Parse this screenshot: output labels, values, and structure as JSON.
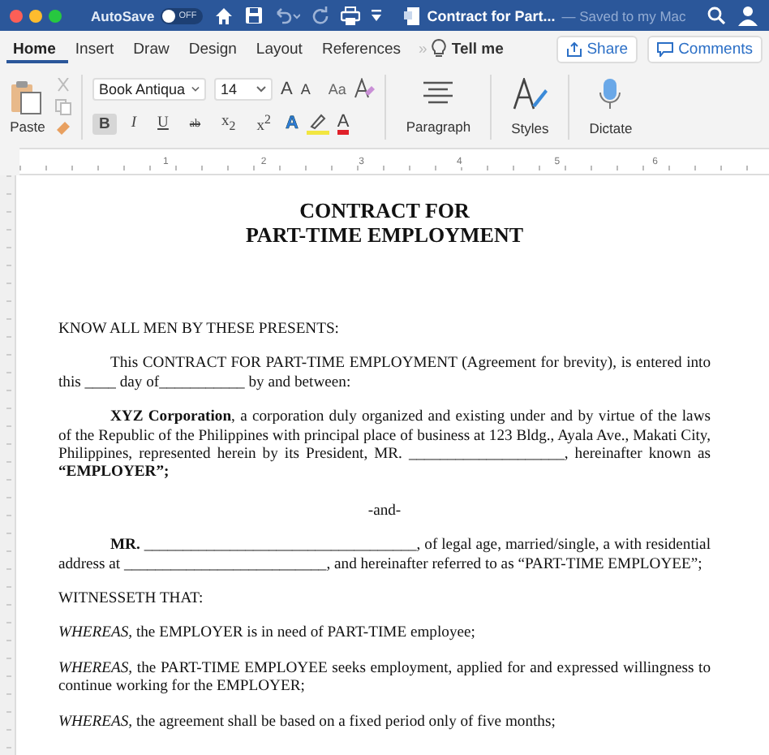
{
  "titlebar": {
    "autosave": {
      "label": "AutoSave",
      "on": false,
      "state_text": "OFF"
    },
    "document_title": "Contract for Part...",
    "saved_status": "— Saved to my Mac"
  },
  "tabs": [
    {
      "label": "Home",
      "selected": true
    },
    {
      "label": "Insert",
      "selected": false
    },
    {
      "label": "Draw",
      "selected": false
    },
    {
      "label": "Design",
      "selected": false
    },
    {
      "label": "Layout",
      "selected": false
    },
    {
      "label": "References",
      "selected": false
    }
  ],
  "overflow": "»",
  "tell_me": "Tell me",
  "share": "Share",
  "comments": "Comments",
  "ribbon": {
    "paste": "Paste",
    "font": {
      "name": "Book Antiqua",
      "size": "14"
    },
    "font_buttons": [
      {
        "label": "A",
        "kind": "grow"
      },
      {
        "label": "A",
        "kind": "shrink"
      },
      {
        "label": "Aa",
        "kind": "case"
      }
    ],
    "format_buttons": [
      {
        "label": "B",
        "kind": "bold",
        "selected": true
      },
      {
        "label": "I",
        "kind": "italic",
        "selected": false
      },
      {
        "label": "U",
        "kind": "underline",
        "selected": false
      },
      {
        "label": "ab",
        "kind": "strike",
        "selected": false
      },
      {
        "label": "x$_{2}$",
        "kind": "plain",
        "selected": false
      },
      {
        "label": "x$^{2}$",
        "kind": "plain",
        "selected": false
      }
    ],
    "color_buttons": [
      {
        "label": "A",
        "kind": "effects",
        "color": "#2f7fe0"
      },
      {
        "kind": "highlight",
        "color": "#f2e640"
      },
      {
        "label": "A",
        "kind": "font_color",
        "color": "#e0202a"
      }
    ],
    "groups": [
      {
        "label": "Paragraph",
        "kind": "paragraph"
      },
      {
        "label": "Styles",
        "kind": "styles"
      },
      {
        "label": "Dictate",
        "kind": "dictate"
      }
    ]
  },
  "ruler": [
    "1",
    "2",
    "3",
    "4",
    "5",
    "6"
  ],
  "document": [
    {
      "kind": "title",
      "lines": [
        "CONTRACT FOR",
        "PART-TIME EMPLOYMENT"
      ]
    },
    {
      "kind": "plain",
      "text": "KNOW ALL MEN BY THESE PRESENTS:"
    },
    {
      "kind": "indent",
      "text": "This CONTRACT FOR PART-TIME EMPLOYMENT (Agreement for brevity), is entered into this ____ day of___________ by and between:"
    },
    {
      "kind": "indent",
      "text": "**XYZ Corporation**, a corporation duly organized and existing under and by virtue of the laws of the Republic of the Philippines with principal place of business at 123 Bldg., Ayala Ave., Makati City, Philippines, represented herein by its President, MR. ____________________, hereinafter known as **“EMPLOYER”;**"
    },
    {
      "kind": "center",
      "text": "-and-"
    },
    {
      "kind": "indent",
      "text": "**MR.** ___________________________________, of legal age, married/single, a with residential address at __________________________, and hereinafter referred to as “PART-TIME EMPLOYEE”;"
    },
    {
      "kind": "plain",
      "text": "WITNESSETH THAT:"
    },
    {
      "kind": "plain",
      "text": "*WHEREAS,* the EMPLOYER is in need of PART-TIME employee;"
    },
    {
      "kind": "plain",
      "text": "*WHEREAS,* the PART-TIME EMPLOYEE seeks employment, applied for and expressed willingness to continue working for the EMPLOYER;"
    },
    {
      "kind": "plain",
      "text": "*WHEREAS,* the agreement shall be based on a fixed period only of five months;"
    }
  ]
}
